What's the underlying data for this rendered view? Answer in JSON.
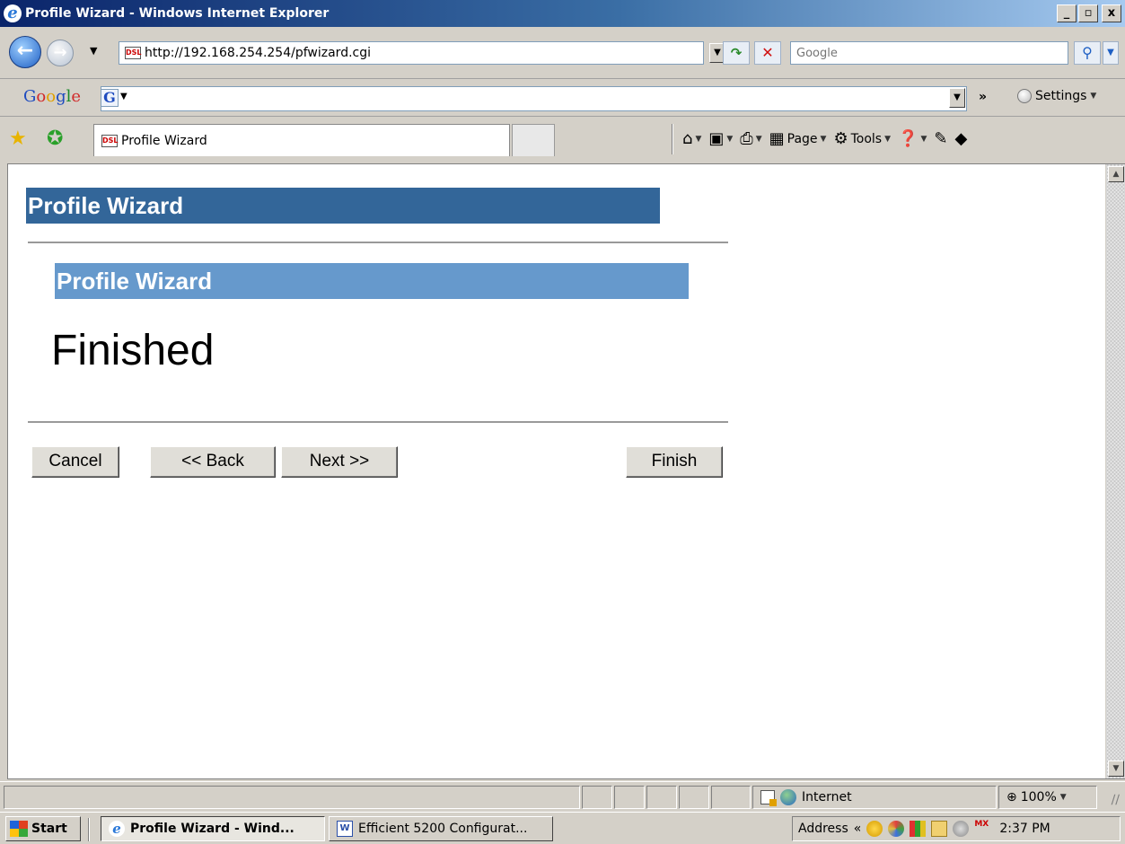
{
  "window": {
    "title": "Profile Wizard - Windows Internet Explorer",
    "minimize": "_",
    "maximize": "▫",
    "close": "x"
  },
  "addressbar": {
    "url": "http://192.168.254.254/pfwizard.cgi",
    "search_placeholder": "Google"
  },
  "google_toolbar": {
    "logo": "Google",
    "g_button": "G",
    "chevron": "»",
    "settings_label": "Settings"
  },
  "tabs": [
    {
      "label": "Profile Wizard",
      "favicon": "DSL"
    }
  ],
  "commandbar": {
    "page_label": "Page",
    "tools_label": "Tools"
  },
  "page": {
    "main_header": "Profile Wizard",
    "sub_header": "Profile Wizard",
    "status_heading": "Finished",
    "buttons": {
      "cancel": "Cancel",
      "back": "<< Back",
      "next": "Next >>",
      "finish": "Finish"
    }
  },
  "statusbar": {
    "zone": "Internet",
    "zoom": "100%"
  },
  "taskbar": {
    "start": "Start",
    "tasks": [
      {
        "label": "Profile Wizard - Wind...",
        "active": true
      },
      {
        "label": "Efficient 5200 Configurat...",
        "active": false
      }
    ],
    "address_label": "Address",
    "tray_mx": "MX",
    "clock": "2:37 PM"
  },
  "colors": {
    "main_header_bg": "#336699",
    "sub_header_bg": "#6699cc"
  }
}
